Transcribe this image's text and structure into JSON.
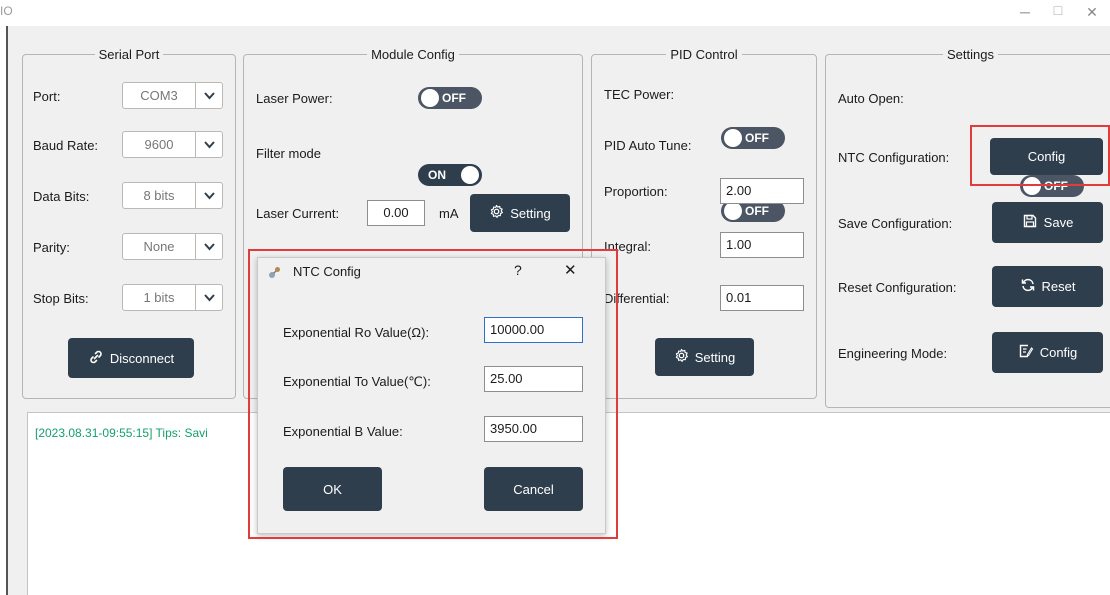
{
  "window": {
    "title": "IO"
  },
  "serial_port": {
    "title": "Serial Port",
    "port_label": "Port:",
    "port_value": "COM3",
    "baud_label": "Baud Rate:",
    "baud_value": "9600",
    "databits_label": "Data Bits:",
    "databits_value": "8 bits",
    "parity_label": "Parity:",
    "parity_value": "None",
    "stopbits_label": "Stop Bits:",
    "stopbits_value": "1 bits",
    "disconnect_label": "Disconnect"
  },
  "module_config": {
    "title": "Module Config",
    "laser_power_label": "Laser Power:",
    "laser_power_state": "OFF",
    "filter_mode_label": "Filter mode",
    "filter_mode_state": "ON",
    "laser_current_label": "Laser Current:",
    "laser_current_value": "0.00",
    "laser_current_unit": "mA",
    "setting_label": "Setting"
  },
  "pid_control": {
    "title": "PID Control",
    "tec_power_label": "TEC Power:",
    "tec_power_state": "OFF",
    "pid_autotune_label": "PID Auto Tune:",
    "pid_autotune_state": "OFF",
    "proportion_label": "Proportion:",
    "proportion_value": "2.00",
    "integral_label": "Integral:",
    "integral_value": "1.00",
    "differential_label": "Differential:",
    "differential_value": "0.01",
    "setting_label": "Setting"
  },
  "settings": {
    "title": "Settings",
    "auto_open_label": "Auto Open:",
    "auto_open_state": "OFF",
    "ntc_label": "NTC Configuration:",
    "ntc_button": "Config",
    "save_label": "Save Configuration:",
    "save_button": "Save",
    "reset_label": "Reset Configuration:",
    "reset_button": "Reset",
    "engineering_label": "Engineering Mode:",
    "engineering_button": "Config"
  },
  "log": {
    "line": "[2023.08.31-09:55:15] Tips: Savi"
  },
  "dialog": {
    "title": "NTC Config",
    "help": "?",
    "close": "✕",
    "ro_label": "Exponential Ro Value(Ω):",
    "ro_value": "10000.00",
    "to_label": "Exponential To Value(℃):",
    "to_value": "25.00",
    "b_label": "Exponential B Value:",
    "b_value": "3950.00",
    "ok": "OK",
    "cancel": "Cancel"
  },
  "colors": {
    "accent": "#2f3e4d",
    "highlight": "#e23b3b",
    "log_text": "#14a06a"
  }
}
